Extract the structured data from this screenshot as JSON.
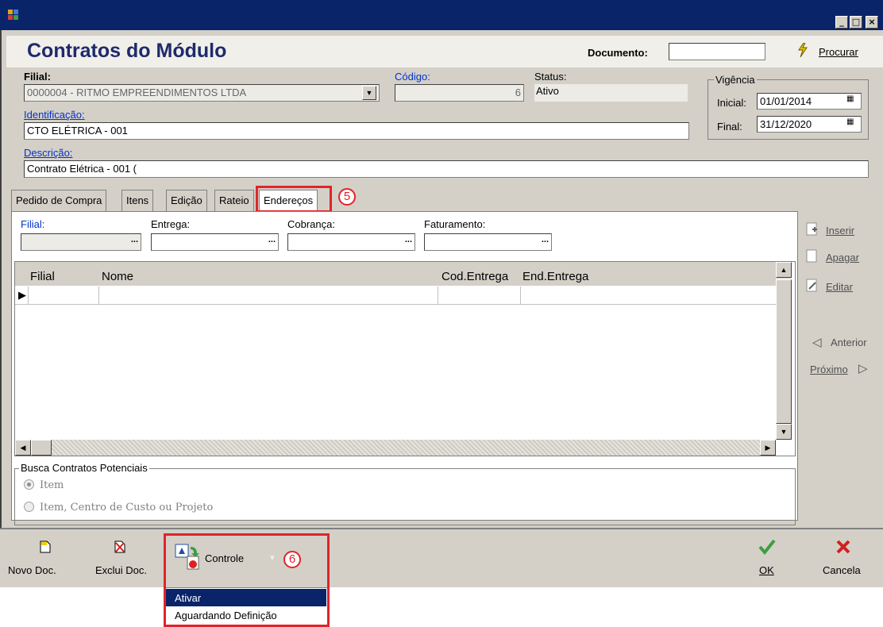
{
  "window": {
    "title": ""
  },
  "header": {
    "title": "Contratos do Módulo",
    "documento_label": "Documento:",
    "documento_value": "",
    "procurar_label": "Procurar"
  },
  "form": {
    "filial_label": "Filial:",
    "filial_value": "0000004 - RITMO EMPREENDIMENTOS LTDA",
    "codigo_label": "Código:",
    "codigo_value": "6",
    "status_label": "Status:",
    "status_value": "Ativo",
    "vigencia_label": "Vigência",
    "inicial_label": "Inicial:",
    "inicial_value": "01/01/2014",
    "final_label": "Final:",
    "final_value": "31/12/2020",
    "identificacao_label": "Identificação:",
    "identificacao_value": "CTO ELÉTRICA - 001",
    "descricao_label": "Descrição:",
    "descricao_value": "Contrato Elétrica - 001 ("
  },
  "tabs": [
    {
      "label": "Pedido de Compra"
    },
    {
      "label": "Itens"
    },
    {
      "label": "Edição"
    },
    {
      "label": "Rateio"
    },
    {
      "label": "Endereços"
    }
  ],
  "annotations": {
    "tab_marker": "5",
    "controle_marker": "6"
  },
  "enderecos": {
    "filial_label": "Filial:",
    "entrega_label": "Entrega:",
    "cobranca_label": "Cobrança:",
    "faturamento_label": "Faturamento:",
    "ellipsis": "...",
    "columns": [
      "Filial",
      "Nome",
      "Cod.Entrega",
      "End.Entrega"
    ]
  },
  "side_buttons": {
    "inserir": "Inserir",
    "apagar": "Apagar",
    "editar": "Editar",
    "anterior": "Anterior",
    "proximo": "Próximo"
  },
  "busca": {
    "title": "Busca Contratos Potenciais",
    "option1": "Item",
    "option2": "Item, Centro de Custo ou Projeto",
    "selected": "Item"
  },
  "toolbar": {
    "novo": "Novo Doc.",
    "exclui": "Exclui Doc.",
    "controle": "Controle",
    "ok": "OK",
    "cancela": "Cancela"
  },
  "controle_menu": {
    "items": [
      "Ativar",
      "Aguardando Definição"
    ],
    "highlighted": "Ativar"
  },
  "colors": {
    "titlebar": "#0a246a",
    "title_text": "#1f2a6b",
    "highlight": "#0a246a",
    "annotation": "#e0242a",
    "link": "#0033cc"
  }
}
